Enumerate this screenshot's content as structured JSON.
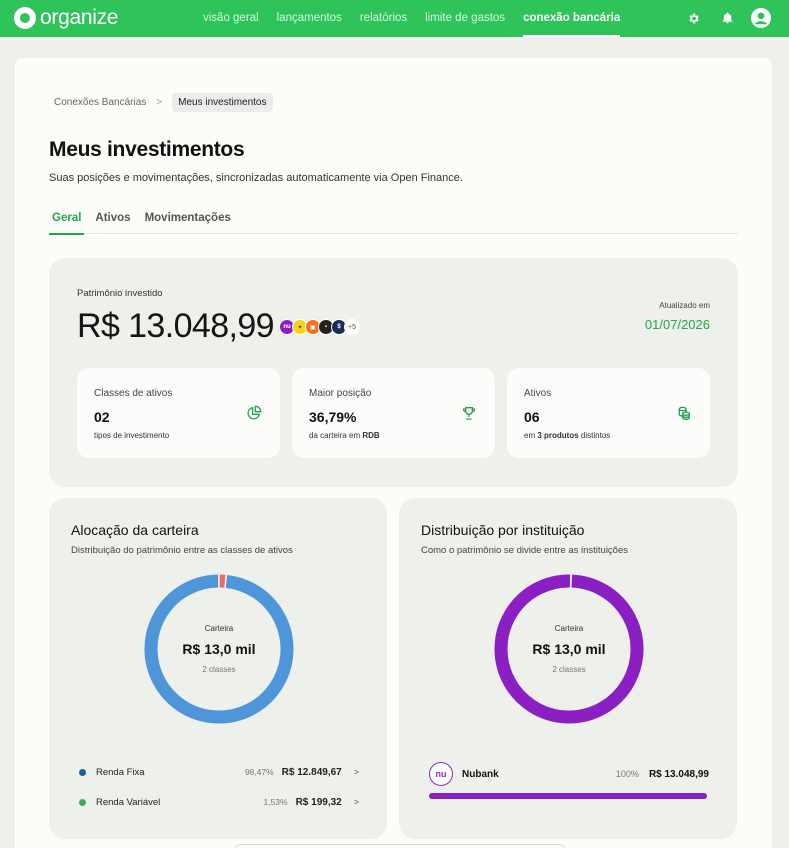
{
  "app": {
    "logo_text": "organize"
  },
  "nav": [
    {
      "label": "visão geral"
    },
    {
      "label": "lançamentos"
    },
    {
      "label": "relatórios"
    },
    {
      "label": "limite de gastos"
    },
    {
      "label": "conexão bancária",
      "active": true
    }
  ],
  "breadcrumb": {
    "parent": "Conexões Bancárias",
    "separator": ">",
    "current": "Meus investimentos"
  },
  "page": {
    "title": "Meus investimentos",
    "subtitle": "Suas posições e movimentações, sincronizadas automaticamente via Open Finance."
  },
  "tabs": [
    {
      "label": "Geral",
      "active": true
    },
    {
      "label": "Ativos"
    },
    {
      "label": "Movimentações"
    }
  ],
  "patrimonio": {
    "label": "Patrimônio investido",
    "value": "R$ 13.048,99",
    "more_banks": "+5",
    "updated_label": "Atualizado em",
    "updated_date": "01/07/2026"
  },
  "stats": [
    {
      "label": "Classes de ativos",
      "value": "02",
      "sub": "tipos de investimento",
      "icon": "pie-chart-icon"
    },
    {
      "label": "Maior posição",
      "value": "36,79%",
      "sub_prefix": "da carteira em ",
      "sub_bold": "RDB",
      "icon": "trophy-icon"
    },
    {
      "label": "Ativos",
      "value": "06",
      "sub_prefix": "em ",
      "sub_bold": "3 produtos",
      "sub_suffix": " distintos",
      "icon": "coins-icon"
    }
  ],
  "allocation": {
    "title": "Alocação da carteira",
    "subtitle": "Distribuição do patrimônio entre as classes de ativos",
    "center_label": "Carteira",
    "center_value": "R$ 13,0 mil",
    "center_sub": "2 classes",
    "items": [
      {
        "name": "Renda Fixa",
        "pct": "98,47%",
        "value": "R$ 12.849,67",
        "color": "#4f95d9"
      },
      {
        "name": "Renda Variável",
        "pct": "1,53%",
        "value": "R$ 199,32",
        "color": "#43a965"
      }
    ]
  },
  "distribution": {
    "title": "Distribuição por instituição",
    "subtitle": "Como o patrimônio se divide entre as instituições",
    "center_label": "Carteira",
    "center_value": "R$ 13,0 mil",
    "center_sub": "2 classes",
    "institution": {
      "name": "Nubank",
      "pct": "100%",
      "value": "R$ 13.048,99",
      "logo_text": "nu",
      "color": "#8a1fc4"
    }
  },
  "chart_data": [
    {
      "type": "pie",
      "title": "Alocação da carteira",
      "categories": [
        "Renda Fixa",
        "Renda Variável"
      ],
      "values": [
        98.47,
        1.53
      ]
    },
    {
      "type": "pie",
      "title": "Distribuição por instituição",
      "categories": [
        "Nubank"
      ],
      "values": [
        100
      ]
    }
  ]
}
